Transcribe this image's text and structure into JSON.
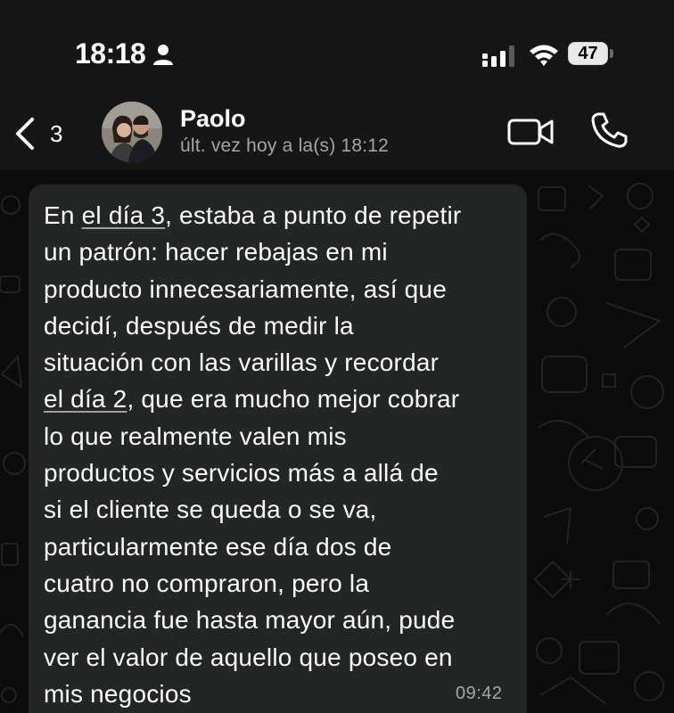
{
  "status_bar": {
    "time": "18:18",
    "battery": "47",
    "icons": [
      "person-icon",
      "signal-icon",
      "wifi-icon",
      "battery-icon"
    ]
  },
  "header": {
    "back_count": "3",
    "contact_name": "Paolo",
    "last_seen": "últ. vez hoy a la(s) 18:12",
    "icons": [
      "back-chevron-icon",
      "video-call-icon",
      "phone-icon"
    ]
  },
  "message": {
    "segments": [
      "En ",
      "el día 3",
      ", estaba a punto de repetir\nun patrón: hacer rebajas en mi\nproducto innecesariamente, así que\ndecidí, después de medir la\nsituación con las varillas y recordar\n",
      "el día 2",
      ", que era mucho mejor cobrar\nlo que realmente valen mis\nproductos y servicios más a allá de\nsi el cliente se queda o se va,\nparticularmente  ese día dos de\ncuatro no compraron, pero la\nganancia fue hasta mayor aún, pude\nver el valor de aquello que poseo en\nmis negocios"
    ],
    "time": "09:42"
  },
  "colors": {
    "background": "#0b0b0b",
    "header": "#161616",
    "bubble": "#242626",
    "secondary_text": "#a5a5a5"
  }
}
